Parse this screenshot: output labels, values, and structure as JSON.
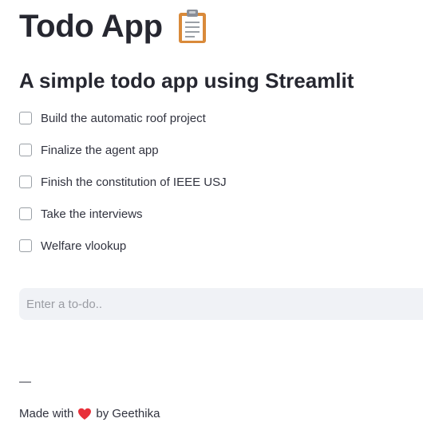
{
  "header": {
    "title": "Todo App",
    "title_icon": "clipboard-icon"
  },
  "subheader": "A simple todo app using Streamlit",
  "todos": [
    {
      "label": "Build the automatic roof project",
      "checked": false
    },
    {
      "label": "Finalize the agent app",
      "checked": false
    },
    {
      "label": "Finish the constitution of IEEE USJ",
      "checked": false
    },
    {
      "label": "Take the interviews",
      "checked": false
    },
    {
      "label": "Welfare vlookup",
      "checked": false
    }
  ],
  "new_todo": {
    "value": "",
    "placeholder": "Enter a to-do.."
  },
  "divider": "—",
  "footer": {
    "prefix": "Made with",
    "icon": "heart-icon",
    "suffix": "by Geethika"
  },
  "colors": {
    "text": "#31333f",
    "input_bg": "#f0f2f6",
    "heart": "#e8303a"
  }
}
